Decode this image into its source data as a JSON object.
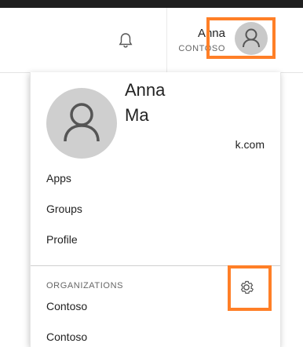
{
  "header": {
    "user_name": "Anna",
    "user_org": "CONTOSO",
    "icons": {
      "notifications": "bell-icon",
      "avatar": "person-icon"
    }
  },
  "profile": {
    "first_name": "Anna",
    "last_name": "Ma",
    "email_fragment": "k.com"
  },
  "menu": {
    "apps": "Apps",
    "groups": "Groups",
    "profile": "Profile"
  },
  "organizations": {
    "label": "ORGANIZATIONS",
    "items": [
      "Contoso",
      "Contoso"
    ],
    "settings_icon": "gear-icon"
  },
  "colors": {
    "highlight": "#ff7f27",
    "avatar_bg": "#c9c9c9"
  }
}
